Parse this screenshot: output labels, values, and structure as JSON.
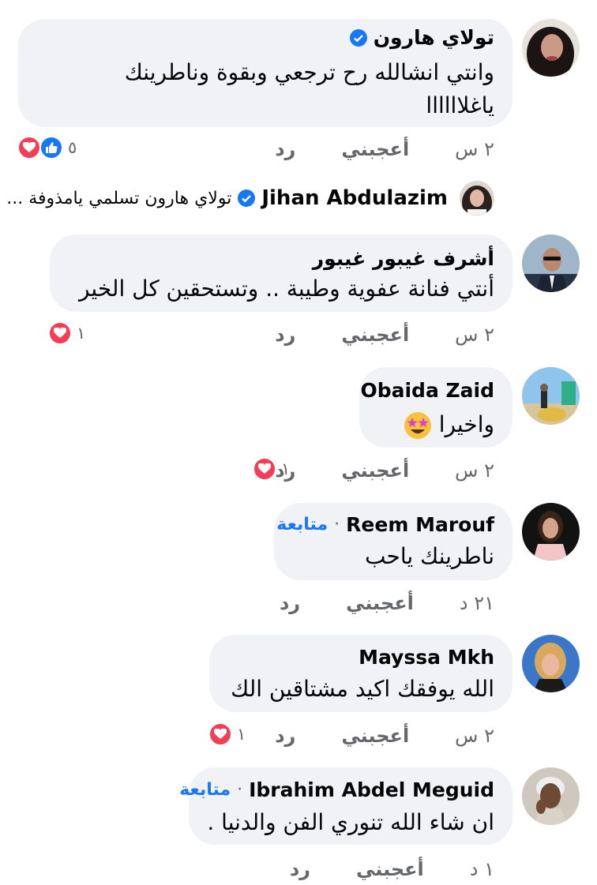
{
  "comments": [
    {
      "name": "تولاي هارون",
      "verified": true,
      "text_lines": [
        "وانتي انشالله رح ترجعي وبقوة وناطرينك",
        "ياغلاااااا"
      ],
      "time": "٢ س",
      "like_label": "أعجبني",
      "reply_label": "رد",
      "reaction_count": "٥",
      "reactions": [
        "heart-icon",
        "like-icon"
      ],
      "avatar": "woman-dark-hair"
    },
    {
      "name": "أشرف غيبور غيبور",
      "text_lines": [
        "أنتي فنانة عفوية وطيبة .. وتستحقين كل الخير"
      ],
      "time": "٢ س",
      "like_label": "أعجبني",
      "reply_label": "رد",
      "reaction_count": "١",
      "reactions": [
        "heart-icon"
      ],
      "avatar": "man-suit-sunglasses"
    },
    {
      "name": "Obaida Zaid",
      "text_lines": [
        "واخيرا"
      ],
      "time": "٢ س",
      "like_label": "أعجبني",
      "reply_label": "رد",
      "reaction_count": "١",
      "reactions": [
        "heart-icon"
      ],
      "avatar": "person-outdoor-sign"
    },
    {
      "name": "Reem Marouf",
      "follow_label": "متابعة",
      "text_lines": [
        "ناطرينك ياحب"
      ],
      "time": "٢١ د",
      "like_label": "أعجبني",
      "reply_label": "رد",
      "avatar": "woman-pink"
    },
    {
      "name": "Mayssa Mkh",
      "text_lines": [
        "الله يوفقك اكيد مشتاقين الك"
      ],
      "time": "٢ س",
      "like_label": "أعجبني",
      "reply_label": "رد",
      "reaction_count": "١",
      "reactions": [
        "heart-icon"
      ],
      "avatar": "woman-blonde"
    },
    {
      "name": "Ibrahim Abdel Meguid",
      "follow_label": "متابعة",
      "text_lines": [
        "ان شاء الله تنوري الفن والدنيا ."
      ],
      "time": "١ د",
      "like_label": "أعجبني",
      "reply_label": "رد",
      "avatar": "elderly-man"
    }
  ],
  "reply_preview": {
    "name": "Jihan Abdulazim",
    "verified": true,
    "text": "تولاي هارون تسلمي يامذوفة ..."
  },
  "colors": {
    "bubble": "#f0f2f5",
    "link": "#1877f2",
    "muted": "#65676b",
    "heart": "#f33e58",
    "like": "#1877f2"
  }
}
